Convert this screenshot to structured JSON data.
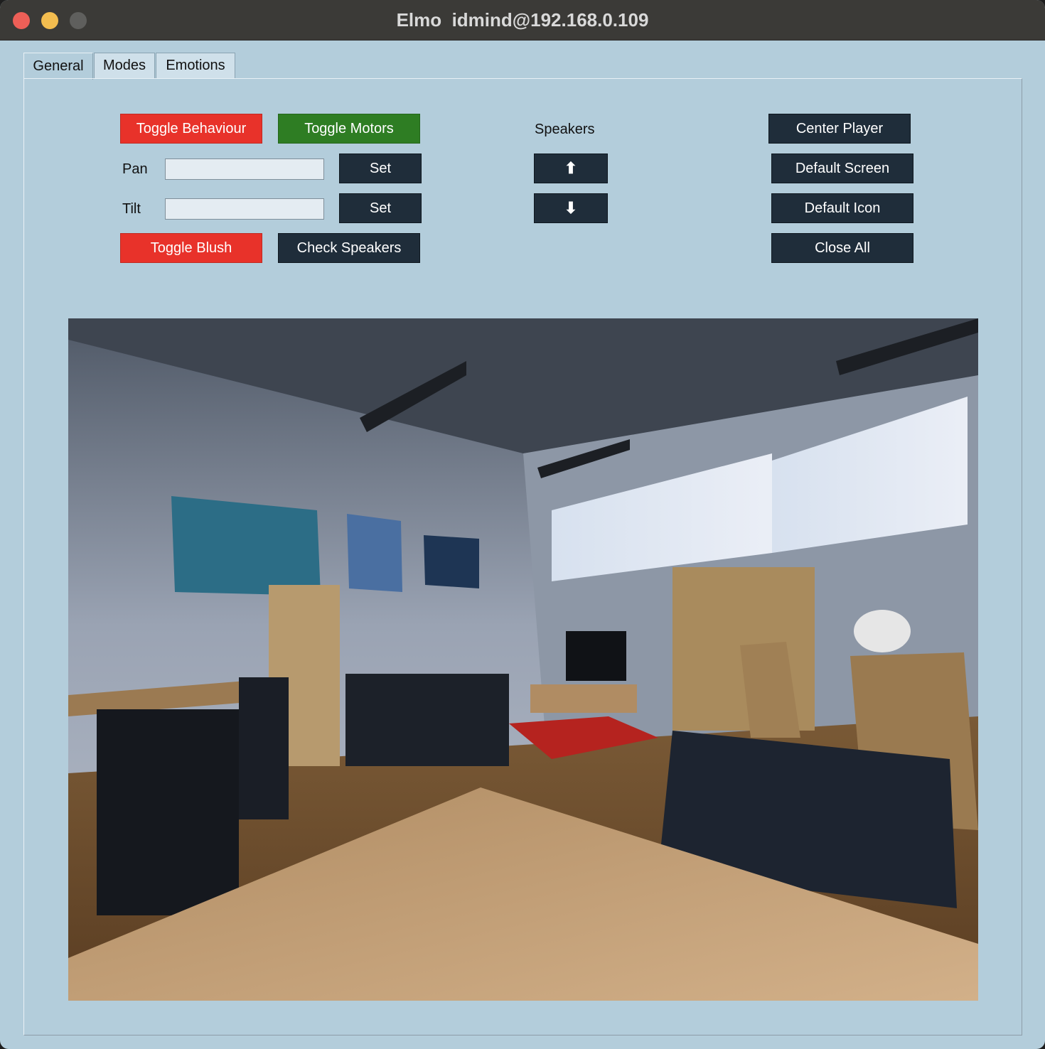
{
  "window": {
    "title": "Elmo  idmind@192.168.0.109"
  },
  "tabs": [
    "General",
    "Modes",
    "Emotions"
  ],
  "controls": {
    "toggle_behaviour": "Toggle Behaviour",
    "toggle_motors": "Toggle Motors",
    "pan_label": "Pan",
    "pan_value": "",
    "tilt_label": "Tilt",
    "tilt_value": "",
    "set_label": "Set",
    "toggle_blush": "Toggle Blush",
    "check_speakers": "Check Speakers",
    "speakers_label": "Speakers",
    "up_arrow": "⬆",
    "down_arrow": "⬇",
    "center_player": "Center Player",
    "default_screen": "Default Screen",
    "default_icon": "Default Icon",
    "close_all": "Close All"
  },
  "colors": {
    "red": "#e8322a",
    "green": "#2e7d23",
    "dark": "#1f2d3a",
    "background": "#b3cddb"
  },
  "camera_feed": {
    "icon": "camera-image"
  }
}
